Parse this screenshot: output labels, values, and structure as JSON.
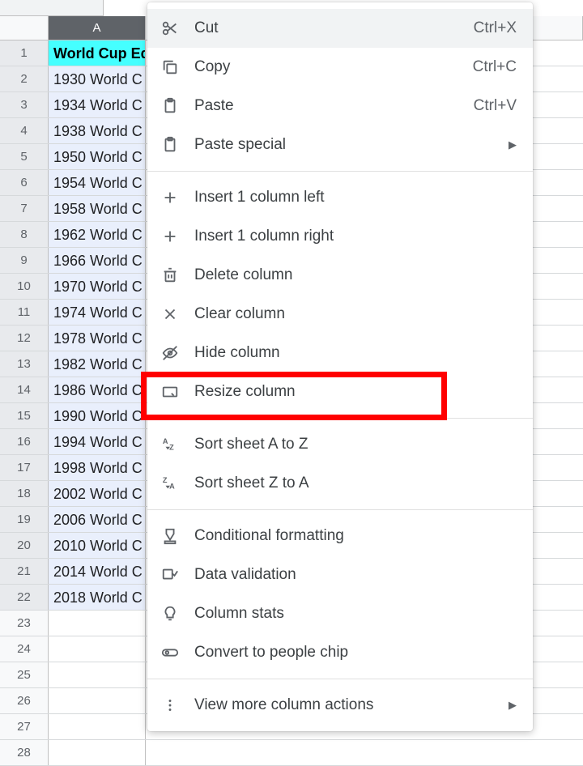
{
  "columnLetter": "A",
  "rows": [
    {
      "n": "1",
      "value": "World Cup Ed",
      "isHeader": true
    },
    {
      "n": "2",
      "value": "1930 World C"
    },
    {
      "n": "3",
      "value": "1934 World C"
    },
    {
      "n": "4",
      "value": "1938 World C"
    },
    {
      "n": "5",
      "value": "1950 World C"
    },
    {
      "n": "6",
      "value": "1954 World C"
    },
    {
      "n": "7",
      "value": "1958 World C"
    },
    {
      "n": "8",
      "value": "1962 World C"
    },
    {
      "n": "9",
      "value": "1966 World C"
    },
    {
      "n": "10",
      "value": "1970 World C"
    },
    {
      "n": "11",
      "value": "1974 World C"
    },
    {
      "n": "12",
      "value": "1978 World C"
    },
    {
      "n": "13",
      "value": "1982 World C"
    },
    {
      "n": "14",
      "value": "1986 World C"
    },
    {
      "n": "15",
      "value": "1990 World C"
    },
    {
      "n": "16",
      "value": "1994 World C"
    },
    {
      "n": "17",
      "value": "1998 World C"
    },
    {
      "n": "18",
      "value": "2002 World C"
    },
    {
      "n": "19",
      "value": "2006 World C"
    },
    {
      "n": "20",
      "value": "2010 World C"
    },
    {
      "n": "21",
      "value": "2014 World C"
    },
    {
      "n": "22",
      "value": "2018 World C"
    },
    {
      "n": "23",
      "value": "",
      "empty": true
    },
    {
      "n": "24",
      "value": "",
      "empty": true
    },
    {
      "n": "25",
      "value": "",
      "empty": true
    },
    {
      "n": "26",
      "value": "",
      "empty": true
    },
    {
      "n": "27",
      "value": "",
      "empty": true
    },
    {
      "n": "28",
      "value": "",
      "empty": true
    }
  ],
  "menu": {
    "cut": {
      "label": "Cut",
      "shortcut": "Ctrl+X"
    },
    "copy": {
      "label": "Copy",
      "shortcut": "Ctrl+C"
    },
    "paste": {
      "label": "Paste",
      "shortcut": "Ctrl+V"
    },
    "pasteSpecial": {
      "label": "Paste special"
    },
    "insertLeft": {
      "label": "Insert 1 column left"
    },
    "insertRight": {
      "label": "Insert 1 column right"
    },
    "deleteColumn": {
      "label": "Delete column"
    },
    "clearColumn": {
      "label": "Clear column"
    },
    "hideColumn": {
      "label": "Hide column"
    },
    "resizeColumn": {
      "label": "Resize column"
    },
    "sortAZ": {
      "label": "Sort sheet A to Z"
    },
    "sortZA": {
      "label": "Sort sheet Z to A"
    },
    "conditionalFmt": {
      "label": "Conditional formatting"
    },
    "dataValidation": {
      "label": "Data validation"
    },
    "columnStats": {
      "label": "Column stats"
    },
    "convertPeople": {
      "label": "Convert to people chip"
    },
    "moreActions": {
      "label": "View more column actions"
    }
  }
}
